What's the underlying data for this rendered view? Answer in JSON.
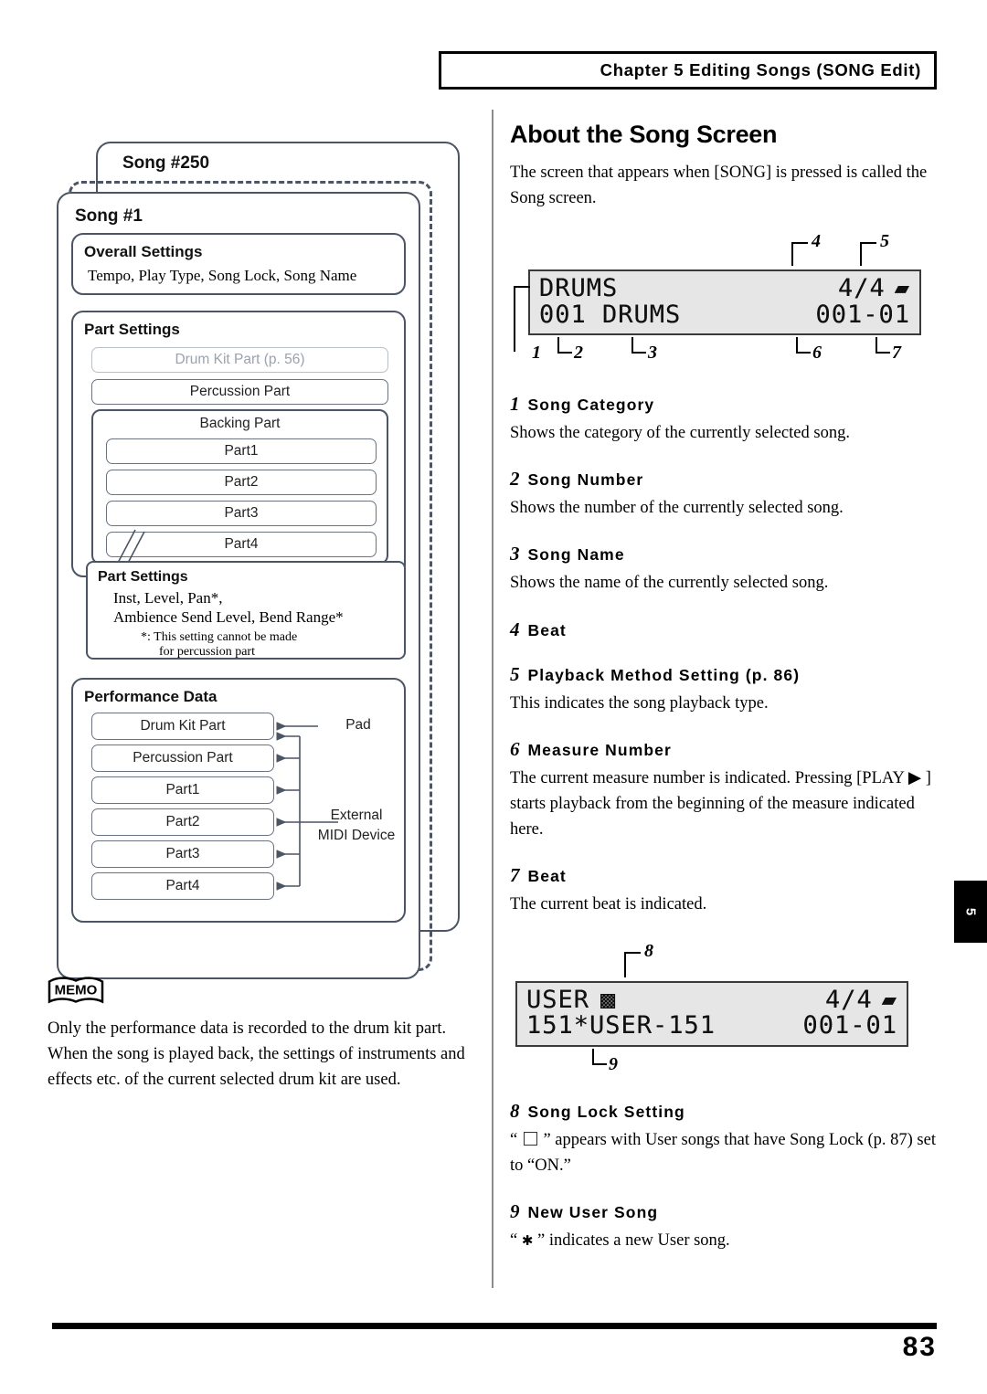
{
  "header": {
    "chapter_text": "Chapter 5 Editing Songs (SONG Edit)"
  },
  "side_tab": {
    "label": "5"
  },
  "footer": {
    "page_number": "83"
  },
  "right_column": {
    "section_title": "About the Song Screen",
    "intro": "The screen that appears when [SONG] is pressed is called the Song screen.",
    "lcd1": {
      "line1_left": "DRUMS",
      "line1_right": "4/4",
      "line1_glyph": "playback-method-glyph",
      "line2_left": "001 DRUMS",
      "line2_right": "001-01",
      "callouts": [
        "1",
        "2",
        "3",
        "4",
        "5",
        "6",
        "7"
      ]
    },
    "lcd2": {
      "line1_left": "USER",
      "line1_lock": "lock-glyph",
      "line1_right": "4/4",
      "line1_glyph": "playback-method-glyph",
      "line2_left": "151*USER-151",
      "line2_right": "001-01",
      "callouts": [
        "8",
        "9"
      ]
    },
    "items": [
      {
        "num": "1",
        "title": "Song Category",
        "body": "Shows the category of the currently selected song."
      },
      {
        "num": "2",
        "title": "Song Number",
        "body": "Shows the number of the currently selected song."
      },
      {
        "num": "3",
        "title": "Song Name",
        "body": "Shows the name of the currently selected song."
      },
      {
        "num": "4",
        "title": "Beat",
        "body": ""
      },
      {
        "num": "5",
        "title": "Playback Method Setting (p. 86)",
        "body": "This indicates the song playback type."
      },
      {
        "num": "6",
        "title": "Measure Number",
        "body": "The current measure number is indicated. Pressing [PLAY ▶ ] starts playback from the beginning of the measure indicated here."
      },
      {
        "num": "7",
        "title": "Beat",
        "body": "The current beat is indicated."
      },
      {
        "num": "8",
        "title": "Song Lock Setting",
        "body_pre": "“",
        "body_post": "” appears with User songs that have Song Lock (p. 87) set to “ON.”"
      },
      {
        "num": "9",
        "title": "New User Song",
        "body_pre": "“",
        "body_post": "” indicates a new User song."
      }
    ]
  },
  "diagram": {
    "outer_label": "Song #250",
    "inner_label": "Song #1",
    "overall_settings": {
      "title": "Overall Settings",
      "body": "Tempo, Play Type, Song Lock, Song Name"
    },
    "part_settings": {
      "title": "Part Settings",
      "drum_kit_part": "Drum Kit Part (p. 56)",
      "percussion_part": "Percussion Part",
      "backing_part": "Backing Part",
      "parts": [
        "Part1",
        "Part2",
        "Part3",
        "Part4"
      ]
    },
    "part_settings_callout": {
      "title": "Part Settings",
      "line1": "Inst, Level, Pan*,",
      "line2": "Ambience Send Level, Bend Range*",
      "note1": "*:  This setting cannot be made",
      "note2": "for percussion part"
    },
    "performance_data": {
      "title": "Performance Data",
      "rows": [
        "Drum Kit Part",
        "Percussion Part",
        "Part1",
        "Part2",
        "Part3",
        "Part4"
      ],
      "source_pad": "Pad",
      "source_midi_line1": "External",
      "source_midi_line2": "MIDI Device"
    }
  },
  "memo": {
    "label": "MEMO",
    "body": "Only the performance data is recorded to the drum kit part. When the song is played back, the settings of instruments and effects etc. of the current selected drum kit are used."
  },
  "colors": {
    "box_border": "#4b5563",
    "lcd_bg": "#e6e6e6",
    "muted_text": "#9aa2ad"
  }
}
